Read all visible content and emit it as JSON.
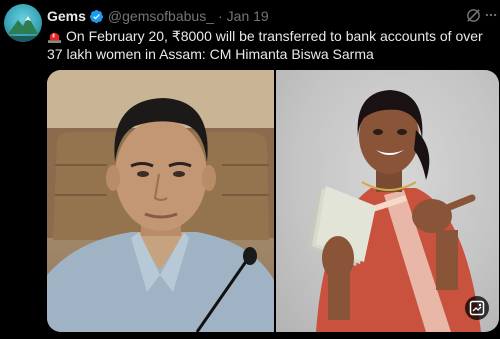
{
  "post": {
    "author_name": "Gems",
    "handle": "@gemsofbabus_",
    "separator": "·",
    "date": "Jan 19",
    "text": "On February 20, ₹8000 will be transferred to bank accounts of over 37 lakh women in Assam: CM Himanta Biswa Sarma"
  },
  "icons": {
    "avatar": "mountain-avatar",
    "verified": "verified-badge-icon",
    "grok": "grok-icon",
    "more": "more-icon",
    "siren": "siren-emoji-icon",
    "media_action": "image-edit-icon"
  },
  "colors": {
    "background": "#000000",
    "text_primary": "#e7e9ea",
    "text_secondary": "#71767b",
    "verified": "#1d9bf0",
    "siren_red": "#e0281f"
  }
}
